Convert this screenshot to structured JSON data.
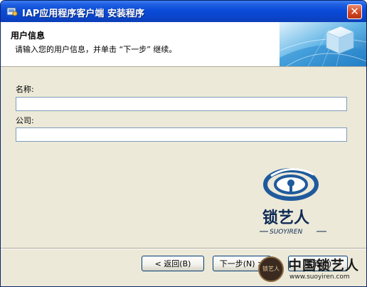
{
  "window": {
    "title": "IAP应用程序客户端 安装程序",
    "close_glyph": "✕"
  },
  "header": {
    "title": "用户信息",
    "subtitle": "请输入您的用户信息，并单击 “下一步” 继续。"
  },
  "form": {
    "name_label": "名称:",
    "name_value": "",
    "company_label": "公司:",
    "company_value": ""
  },
  "logo": {
    "brand_text": "锁艺人",
    "brand_sub": "SUOYIREN",
    "colors": {
      "primary": "#1f5a9c",
      "dark": "#0e2a55"
    }
  },
  "buttons": {
    "back_label": "< 返回(B)",
    "next_label": "下一步(N) >",
    "cancel_label": "取消(C)"
  },
  "watermark": {
    "title": "中国锁艺人",
    "url": "www.suoyiren.com",
    "seal_text": "锁艺人"
  },
  "colors": {
    "titlebar": "#0b4bd8",
    "dialog_bg": "#ece9d8",
    "field_border": "#7f9db9"
  },
  "icons": {
    "title": "installer-icon",
    "close": "close-icon"
  }
}
